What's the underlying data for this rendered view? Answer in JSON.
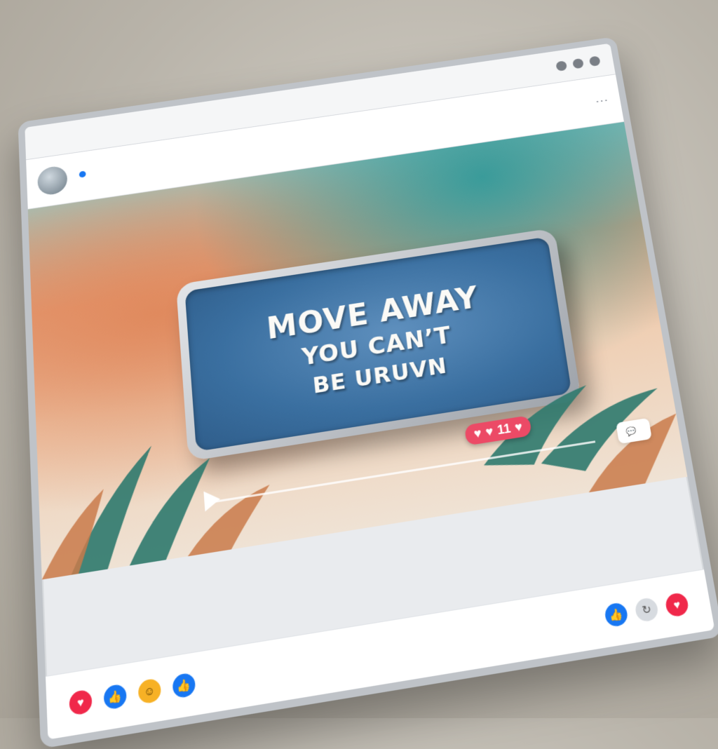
{
  "colors": {
    "accent": "#1877f2",
    "love": "#f0284a",
    "badge": "#ec4a66",
    "plate": "#3a6fa0"
  },
  "post": {
    "author": "",
    "subtitle": "",
    "more_icon": "⋯"
  },
  "media": {
    "plate_lines": [
      "MOVE AWAY",
      "YOU CAN’T",
      "BE URUVN"
    ],
    "reaction_badge_count": "11",
    "time_label": "",
    "comment_title": "",
    "comment_body": ""
  },
  "actions": {
    "label_1": "",
    "label_2": ""
  },
  "icons": {
    "like": "like-icon",
    "love": "heart-icon",
    "care": "care-icon",
    "share": "share-icon",
    "play": "play-icon",
    "chat": "chat-bubble-icon"
  }
}
